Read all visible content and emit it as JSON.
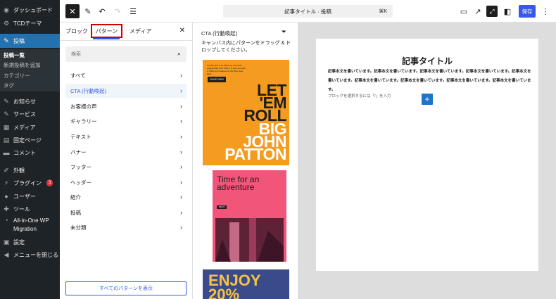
{
  "admin_menu": {
    "items": [
      {
        "label": "ダッシュボード",
        "icon": "dashboard-icon",
        "glyph": "◉"
      },
      {
        "label": "TCDテーマ",
        "icon": "gear-icon",
        "glyph": "⚙"
      },
      {
        "label": "投稿",
        "icon": "pin-icon",
        "glyph": "✎"
      },
      {
        "label": "お知らせ",
        "icon": "pin-icon",
        "glyph": "✎"
      },
      {
        "label": "サービス",
        "icon": "pin-icon",
        "glyph": "✎"
      },
      {
        "label": "メディア",
        "icon": "media-icon",
        "glyph": "▦"
      },
      {
        "label": "固定ページ",
        "icon": "page-icon",
        "glyph": "▤"
      },
      {
        "label": "コメント",
        "icon": "comment-icon",
        "glyph": "▬"
      },
      {
        "label": "外観",
        "icon": "brush-icon",
        "glyph": "✐"
      },
      {
        "label": "プラグイン",
        "icon": "plugin-icon",
        "glyph": "⚡"
      },
      {
        "label": "ユーザー",
        "icon": "user-icon",
        "glyph": "●"
      },
      {
        "label": "ツール",
        "icon": "wrench-icon",
        "glyph": "✚"
      },
      {
        "label": "All-in-One WP",
        "icon": "migration-icon",
        "glyph": "◔"
      },
      {
        "label": "Migration",
        "icon": "",
        "glyph": ""
      },
      {
        "label": "設定",
        "icon": "settings-icon",
        "glyph": "▣"
      },
      {
        "label": "メニューを閉じる",
        "icon": "collapse-icon",
        "glyph": "◀"
      }
    ],
    "submenu": [
      "投稿一覧",
      "新規投稿を追加",
      "カテゴリー",
      "タグ"
    ],
    "plugin_badge": "3"
  },
  "topbar": {
    "close_glyph": "✕",
    "pen_glyph": "✎",
    "undo_glyph": "↶",
    "redo_glyph": "↷",
    "list_glyph": "☰",
    "doc_title": "記事タイトル · 投稿",
    "shortcut": "⌘K",
    "preview_glyph": "▭",
    "external_glyph": "↗",
    "focus_glyph": "⤢",
    "settings_glyph": "◧",
    "save_label": "保存",
    "more_glyph": "⋮"
  },
  "inserter": {
    "tabs": [
      "ブロック",
      "パターン",
      "メディア"
    ],
    "close_glyph": "✕",
    "search_placeholder": "検索",
    "search_glyph": "⌕",
    "categories": [
      "すべて",
      "CTA (行動喚起)",
      "お客様の声",
      "ギャラリー",
      "テキスト",
      "バナー",
      "フッター",
      "ヘッダー",
      "紹介",
      "投稿",
      "未分類"
    ],
    "selected_category_index": 1,
    "chevron": "›",
    "all_patterns_label": "すべてのパターンを表示"
  },
  "patterns": {
    "title": "CTA (行動喚起)",
    "filter_glyph": "⏷",
    "description": "キャンバス内にパターンをドラッグ & ドロップしてください。",
    "card1": {
      "small_text": "Let 'Em Roll is an album by American organist Big John Patton. It was recorded in 1965 and released on the Blue Note label.",
      "button": "SHOP NOW",
      "lines_dark": [
        "LET",
        "'EM",
        "ROLL"
      ],
      "lines_light": [
        "BIG",
        "JOHN",
        "PATTON"
      ],
      "bg_color": "#f49b20"
    },
    "card2": {
      "title": "Time for an adventure",
      "button": "ABOUT",
      "bg_color": "#f2557a"
    },
    "card3": {
      "lines": [
        "ENJOY",
        "20%"
      ],
      "bg_color": "#3a4b8c"
    }
  },
  "canvas": {
    "post_title": "記事タイトル",
    "body_text": "記事本文を書いています。記事本文を書いています。記事本文を書いています。記事本文を書いています。記事本文を書いています。記事本文を書いています。記事本文を書いています。記事本文を書いています。記事本文を書いています。",
    "block_prompt": "ブロックを選択するには「/」を入力",
    "add_glyph": "+"
  }
}
